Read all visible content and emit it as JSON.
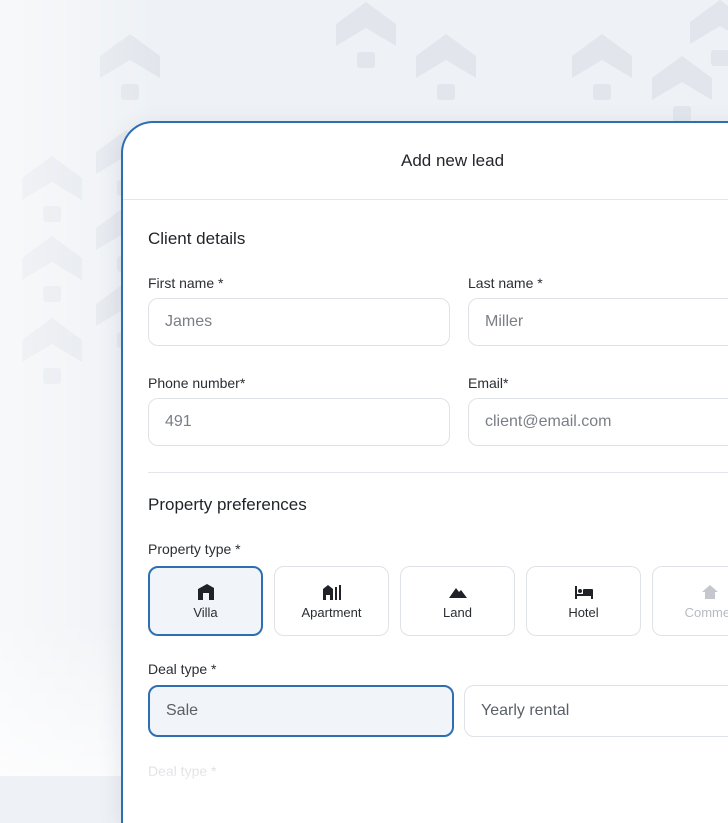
{
  "modal": {
    "title": "Add new lead"
  },
  "client_details": {
    "title": "Client details",
    "first_name": {
      "label": "First name *",
      "value": "James"
    },
    "last_name": {
      "label": "Last name *",
      "value": "Miller"
    },
    "phone": {
      "label": "Phone number*",
      "value": "491"
    },
    "email": {
      "label": "Email*",
      "placeholder": "client@email.com"
    }
  },
  "property_preferences": {
    "title": "Property preferences",
    "property_type_label": "Property type *",
    "types": [
      {
        "label": "Villa",
        "icon": "villa-icon",
        "selected": true
      },
      {
        "label": "Apartment",
        "icon": "apartment-icon",
        "selected": false
      },
      {
        "label": "Land",
        "icon": "land-icon",
        "selected": false
      },
      {
        "label": "Hotel",
        "icon": "hotel-icon",
        "selected": false
      },
      {
        "label": "Commer",
        "icon": "house-icon",
        "selected": false
      }
    ],
    "deal_type_label": "Deal type *",
    "deal_options": [
      {
        "label": "Sale",
        "selected": true
      },
      {
        "label": "Yearly rental",
        "selected": false
      }
    ],
    "next_label_ghost": "Deal type *"
  },
  "colors": {
    "accent": "#2c6fb3",
    "border": "#dfe2e6",
    "background": "#eef1f5"
  }
}
